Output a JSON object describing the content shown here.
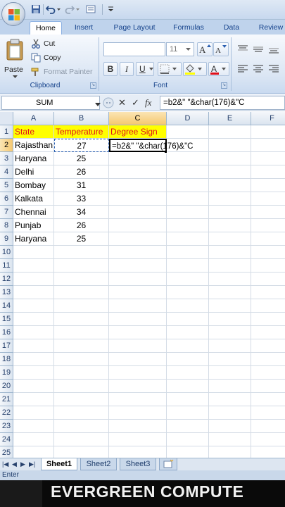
{
  "ribbon": {
    "tabs": [
      "Home",
      "Insert",
      "Page Layout",
      "Formulas",
      "Data",
      "Review"
    ],
    "active_tab": "Home",
    "clipboard": {
      "paste_label": "Paste",
      "cut_label": "Cut",
      "copy_label": "Copy",
      "format_painter_label": "Format Painter",
      "group_label": "Clipboard"
    },
    "font": {
      "font_size": "11",
      "group_label": "Font",
      "bold_label": "B",
      "italic_label": "I",
      "underline_label": "U"
    }
  },
  "formula_bar": {
    "name_box": "SUM",
    "cancel_symbol": "✕",
    "enter_symbol": "✓",
    "fx_symbol": "fx",
    "formula": "=b2&\" \"&char(176)&\"C"
  },
  "grid": {
    "columns": [
      "A",
      "B",
      "C",
      "D",
      "E",
      "F"
    ],
    "row_numbers": [
      "1",
      "2",
      "3",
      "4",
      "5",
      "6",
      "7",
      "8",
      "9",
      "10",
      "11",
      "12",
      "13",
      "14",
      "15",
      "16",
      "17",
      "18",
      "19",
      "20",
      "21",
      "22",
      "23",
      "24",
      "25"
    ],
    "header_row": [
      "State",
      "Temperature",
      "Degree Sign"
    ],
    "rows": [
      {
        "state": "Rajasthan",
        "temp": "27"
      },
      {
        "state": "Haryana",
        "temp": "25"
      },
      {
        "state": "Delhi",
        "temp": "26"
      },
      {
        "state": "Bombay",
        "temp": "31"
      },
      {
        "state": "Kalkata",
        "temp": "33"
      },
      {
        "state": "Chennai",
        "temp": "34"
      },
      {
        "state": "Punjab",
        "temp": "26"
      },
      {
        "state": "Haryana",
        "temp": "25"
      }
    ],
    "editing_cell_text": "=b2&\" \"&char(176)&\"C",
    "active_cell": "C2"
  },
  "sheets": {
    "tabs": [
      "Sheet1",
      "Sheet2",
      "Sheet3"
    ],
    "active": "Sheet1"
  },
  "status": {
    "mode": "Enter"
  },
  "banner": {
    "text": "EVERGREEN COMPUTE"
  },
  "colors": {
    "header_fill": "#ffff00",
    "header_text": "#e0101a",
    "ribbon_blue": "#15428b"
  }
}
